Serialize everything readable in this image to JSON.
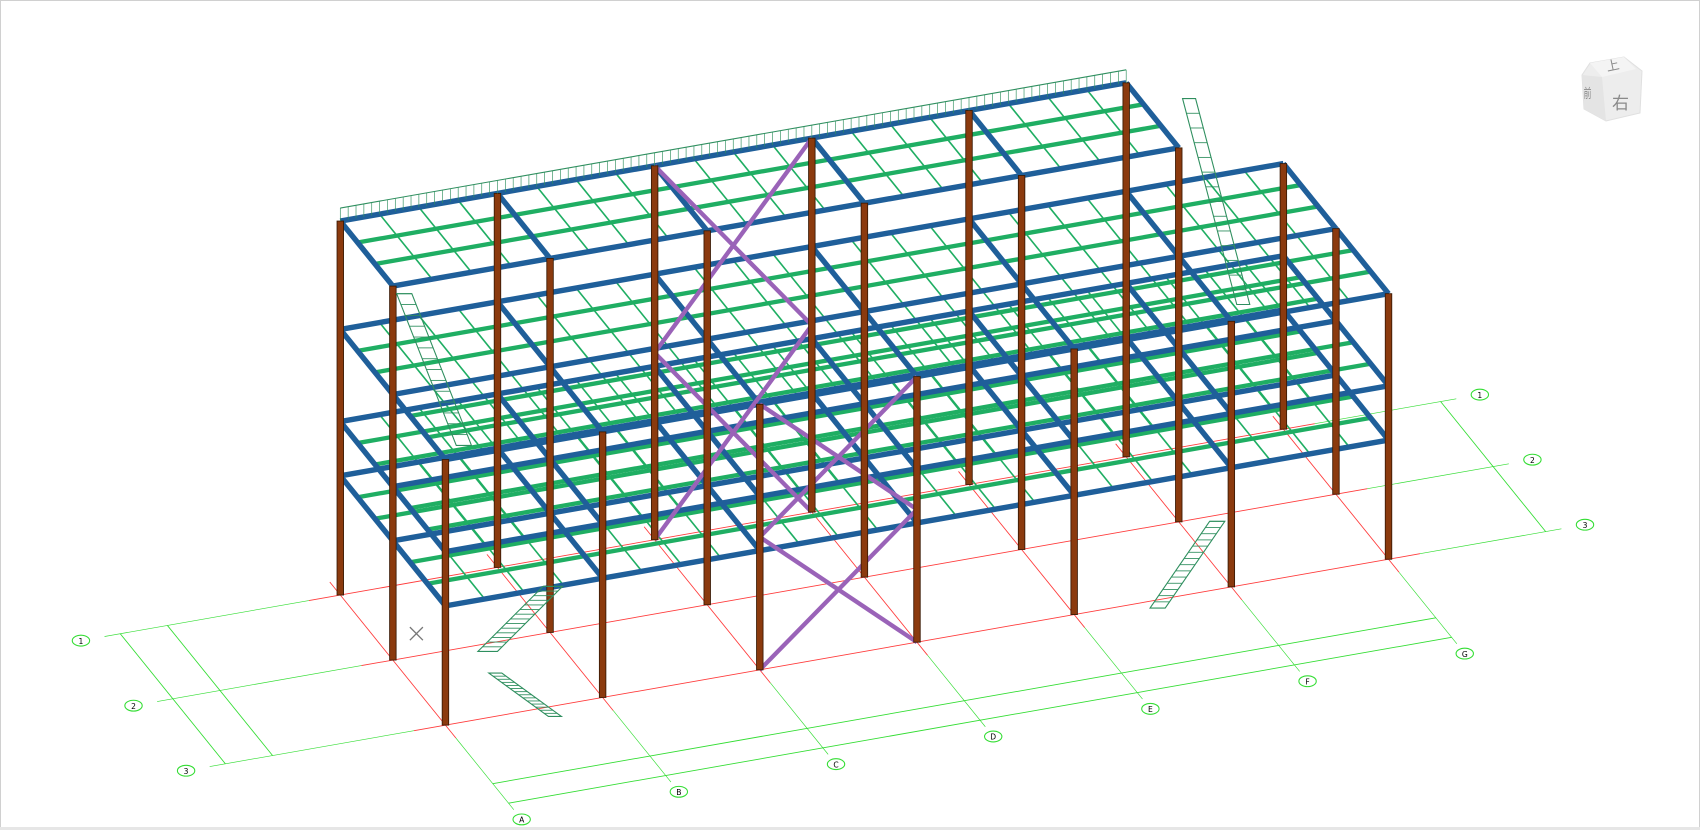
{
  "view_cube": {
    "top": "上",
    "front": "前",
    "right": "右"
  },
  "grid": {
    "letters": [
      "A",
      "B",
      "C",
      "D",
      "E",
      "F",
      "G"
    ],
    "numbers": [
      "1",
      "2",
      "3"
    ]
  },
  "colors": {
    "column": "#8b3a0e",
    "main_beam": "#1f5f9a",
    "secondary_beam": "#1fae63",
    "bracing": "#9a63b8",
    "grid_line": "#ff3b3b",
    "dimension_line": "#33dd33",
    "railing": "#2f8f5f"
  }
}
